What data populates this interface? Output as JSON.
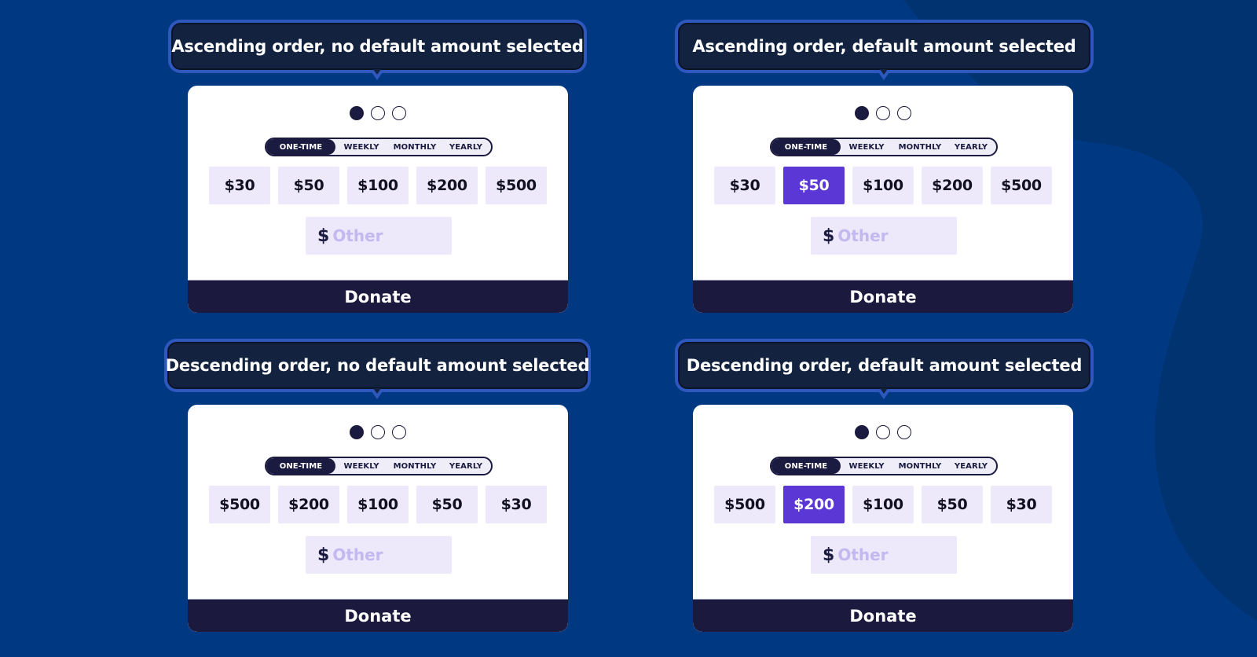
{
  "colors": {
    "background": "#003882",
    "background_shape": "#003370",
    "label_bg": "#12223f",
    "label_ring": "#2f58bf",
    "card_bg": "#ffffff",
    "navy": "#1b1a40",
    "amount_bg": "#ede9fa",
    "selected_amount_bg": "#5b37d6",
    "placeholder": "#c3b8ef"
  },
  "panels": [
    {
      "label": "Ascending order, no default amount selected",
      "steps": {
        "total": 3,
        "current": 1
      },
      "frequency_tabs": [
        "ONE-TIME",
        "WEEKLY",
        "MONTHLY",
        "YEARLY"
      ],
      "active_frequency": "ONE-TIME",
      "amounts": [
        "$30",
        "$50",
        "$100",
        "$200",
        "$500"
      ],
      "selected_amount": null,
      "other": {
        "currency": "$",
        "placeholder": "Other",
        "value": ""
      },
      "donate_label": "Donate"
    },
    {
      "label": "Ascending order, default amount selected",
      "steps": {
        "total": 3,
        "current": 1
      },
      "frequency_tabs": [
        "ONE-TIME",
        "WEEKLY",
        "MONTHLY",
        "YEARLY"
      ],
      "active_frequency": "ONE-TIME",
      "amounts": [
        "$30",
        "$50",
        "$100",
        "$200",
        "$500"
      ],
      "selected_amount": "$50",
      "other": {
        "currency": "$",
        "placeholder": "Other",
        "value": ""
      },
      "donate_label": "Donate"
    },
    {
      "label": "Descending order, no default amount selected",
      "steps": {
        "total": 3,
        "current": 1
      },
      "frequency_tabs": [
        "ONE-TIME",
        "WEEKLY",
        "MONTHLY",
        "YEARLY"
      ],
      "active_frequency": "ONE-TIME",
      "amounts": [
        "$500",
        "$200",
        "$100",
        "$50",
        "$30"
      ],
      "selected_amount": null,
      "other": {
        "currency": "$",
        "placeholder": "Other",
        "value": ""
      },
      "donate_label": "Donate"
    },
    {
      "label": "Descending order, default amount selected",
      "steps": {
        "total": 3,
        "current": 1
      },
      "frequency_tabs": [
        "ONE-TIME",
        "WEEKLY",
        "MONTHLY",
        "YEARLY"
      ],
      "active_frequency": "ONE-TIME",
      "amounts": [
        "$500",
        "$200",
        "$100",
        "$50",
        "$30"
      ],
      "selected_amount": "$200",
      "other": {
        "currency": "$",
        "placeholder": "Other",
        "value": ""
      },
      "donate_label": "Donate"
    }
  ]
}
